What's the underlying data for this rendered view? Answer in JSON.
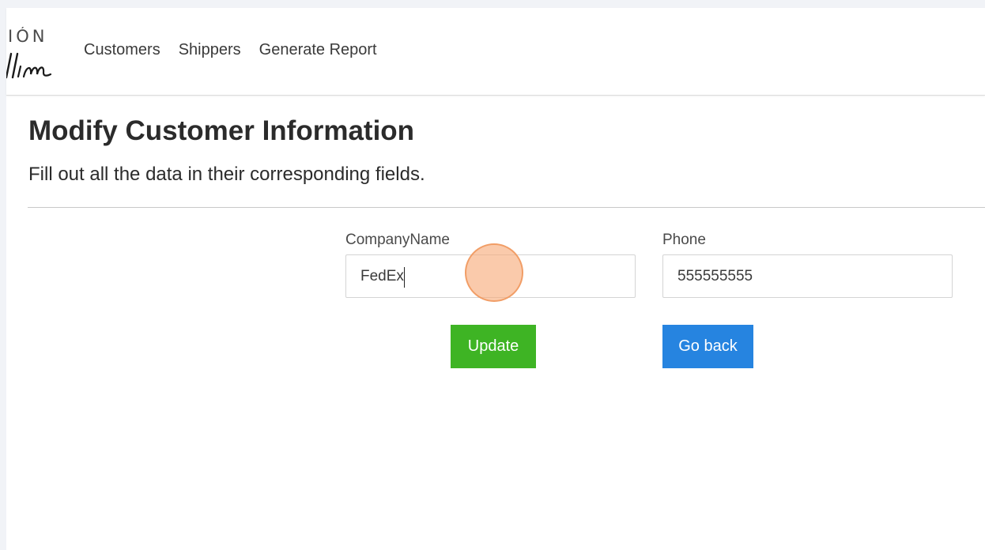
{
  "logo": {
    "top_text": "IÓN",
    "script_text": "llim"
  },
  "nav": {
    "items": [
      {
        "label": "Customers"
      },
      {
        "label": "Shippers"
      },
      {
        "label": "Generate Report"
      }
    ]
  },
  "page": {
    "title": "Modify Customer Information",
    "subtitle": "Fill out all the data in their corresponding fields."
  },
  "form": {
    "company_name": {
      "label": "CompanyName",
      "value": "FedEx"
    },
    "phone": {
      "label": "Phone",
      "value": "555555555"
    },
    "update_label": "Update",
    "back_label": "Go back"
  },
  "colors": {
    "update_button": "#3eb424",
    "back_button": "#2684e0",
    "click_indicator": "#f7aa78"
  }
}
